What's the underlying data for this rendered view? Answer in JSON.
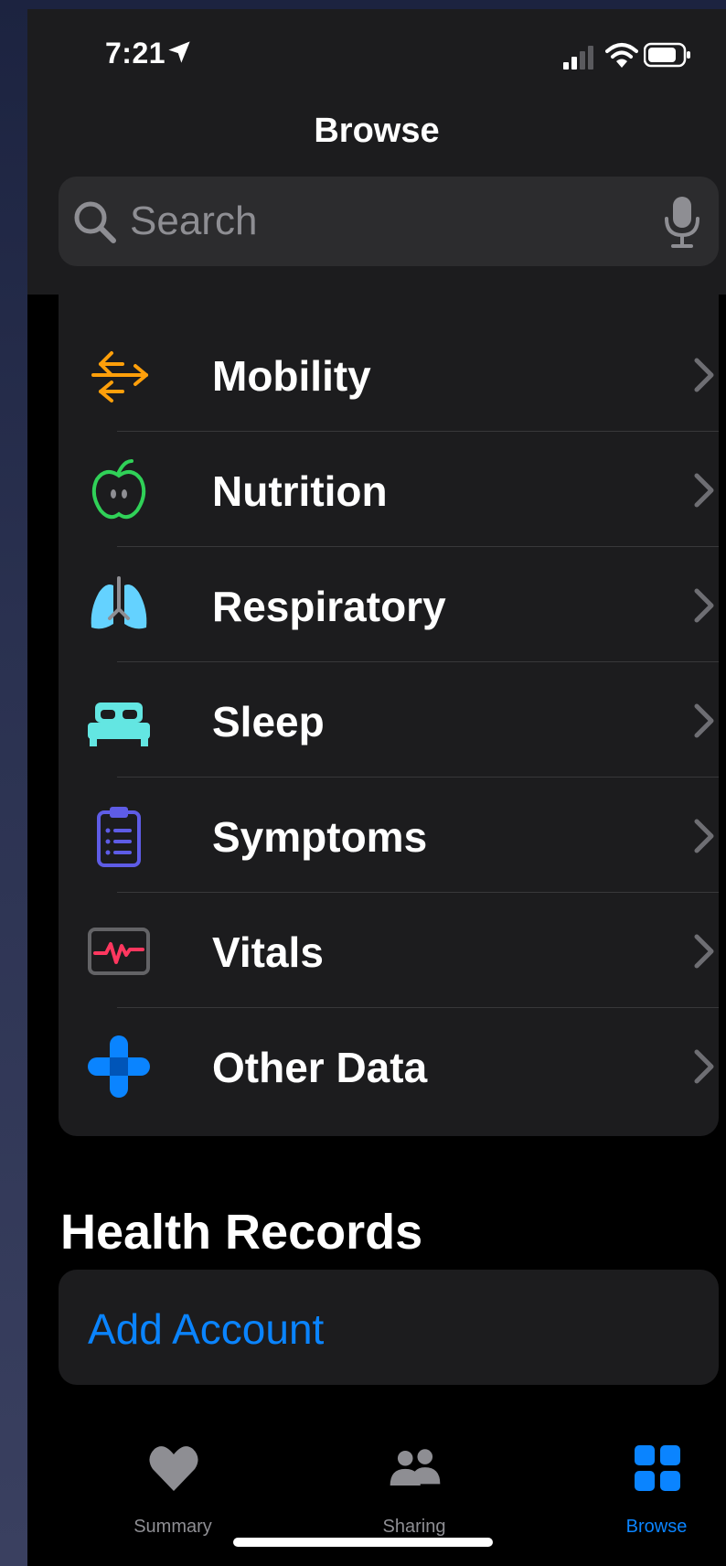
{
  "status": {
    "time": "7:21"
  },
  "nav": {
    "title": "Browse"
  },
  "search": {
    "placeholder": "Search"
  },
  "categories": [
    {
      "label": "Mobility",
      "icon": "mobility-arrows-icon",
      "color": "#ff9f0a"
    },
    {
      "label": "Nutrition",
      "icon": "apple-icon",
      "color": "#30d158"
    },
    {
      "label": "Respiratory",
      "icon": "lungs-icon",
      "color": "#64d2ff"
    },
    {
      "label": "Sleep",
      "icon": "bed-icon",
      "color": "#63e6e2"
    },
    {
      "label": "Symptoms",
      "icon": "clipboard-icon",
      "color": "#5e5ce6"
    },
    {
      "label": "Vitals",
      "icon": "heart-monitor-icon",
      "color": "#ff375f"
    },
    {
      "label": "Other Data",
      "icon": "plus-cross-icon",
      "color": "#0a84ff"
    }
  ],
  "health_records": {
    "title": "Health Records",
    "add_account": "Add Account"
  },
  "tabs": [
    {
      "label": "Summary",
      "icon": "heart-icon",
      "active": false
    },
    {
      "label": "Sharing",
      "icon": "people-icon",
      "active": false
    },
    {
      "label": "Browse",
      "icon": "grid-icon",
      "active": true
    }
  ],
  "colors": {
    "accent": "#0a84ff",
    "background": "#000000",
    "card": "#1c1c1e",
    "search_field": "#2c2c2e",
    "secondary_text": "#8e8e93"
  }
}
